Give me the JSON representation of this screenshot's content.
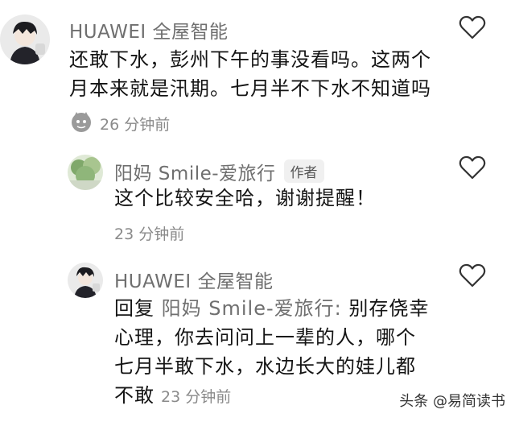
{
  "comments": [
    {
      "username": "HUAWEI 全屋智能",
      "lines": [
        "还敢下水，彭州下午的事没看吗。这两个",
        "月本来就是汛期。七月半不下水不知道吗"
      ],
      "time": "26 分钟前",
      "icon": "emoji-face-icon"
    },
    {
      "username": "阳妈 Smile-爱旅行",
      "badge": "作者",
      "lines": [
        "这个比较安全哈，谢谢提醒！"
      ],
      "time": "23 分钟前"
    },
    {
      "username": "HUAWEI 全屋智能",
      "reply_prefix": "回复",
      "reply_target": "阳妈 Smile-爱旅行:",
      "lines": [
        "别存侥幸",
        "心理，你去问问上一辈的人，哪个",
        "七月半敢下水，水边长大的娃儿都",
        "不敢"
      ],
      "time": "23 分钟前"
    }
  ],
  "watermark": "头条 @易简读书",
  "icons": {
    "like": "heart-outline-icon"
  }
}
